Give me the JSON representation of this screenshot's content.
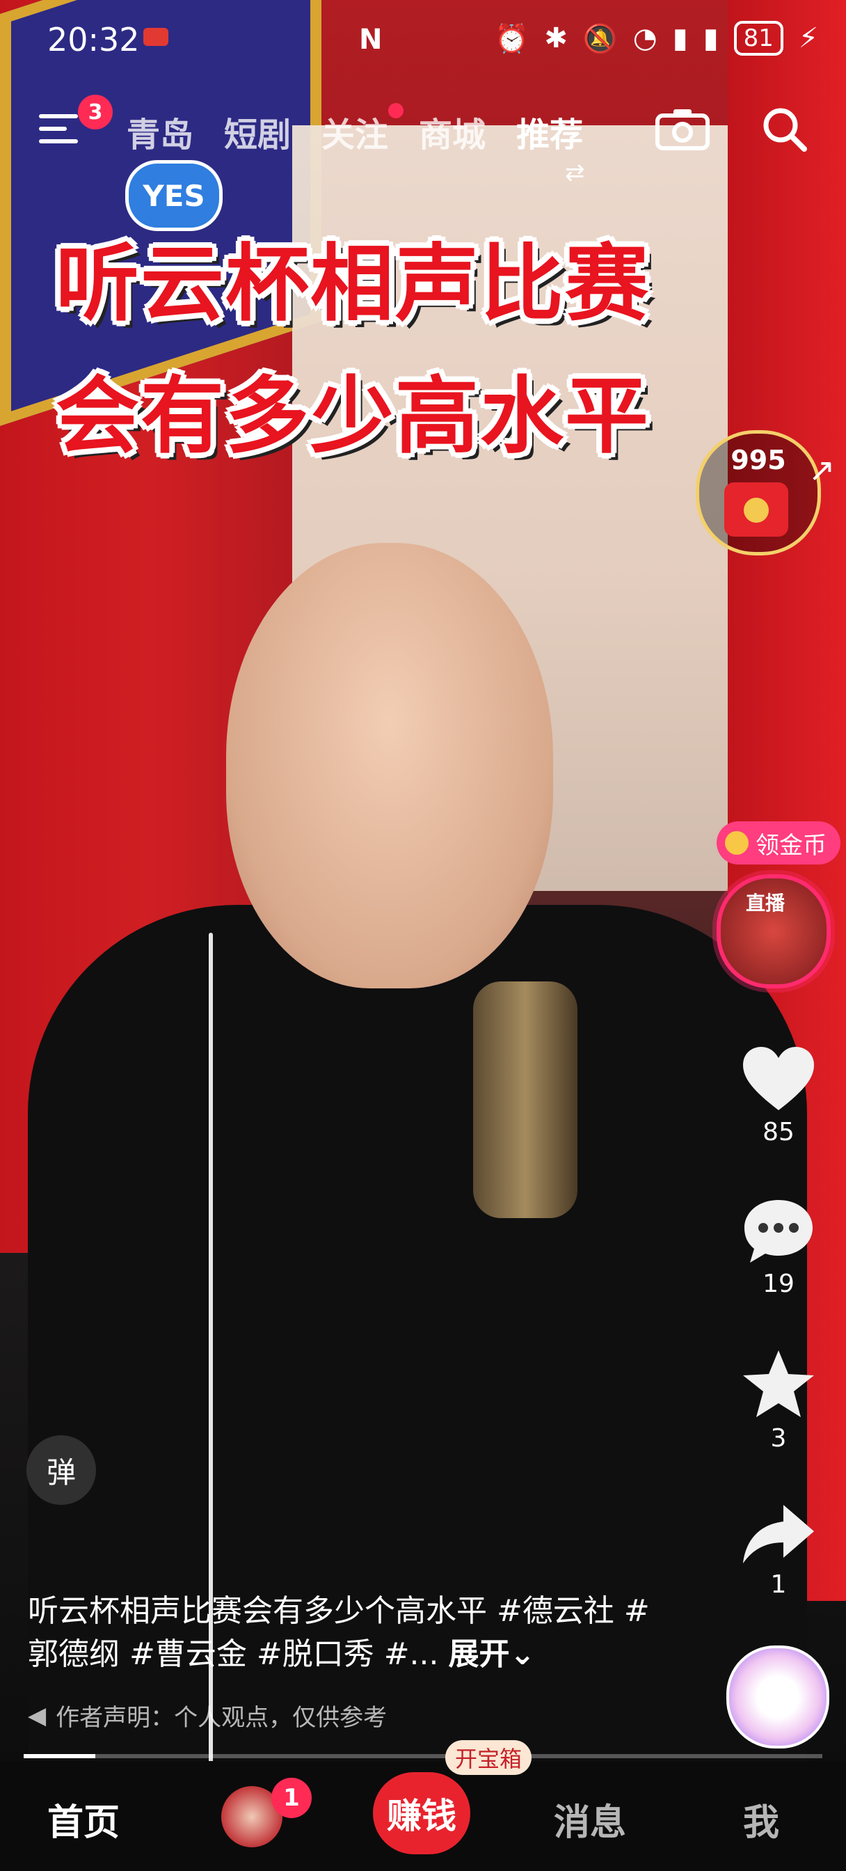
{
  "status_bar": {
    "time": "20:32",
    "nfc": "N",
    "battery": "81"
  },
  "top_nav": {
    "menu_badge": "3",
    "tabs": [
      {
        "label": "青岛"
      },
      {
        "label": "短剧"
      },
      {
        "label": "关注"
      },
      {
        "label": "商城"
      },
      {
        "label": "推荐"
      }
    ],
    "active_tab": "推荐",
    "swap_glyph": "⇄"
  },
  "video": {
    "caption_line1": "听云杯相声比赛",
    "caption_line2": "会有多少高水平",
    "yes_bubble": "YES"
  },
  "red_packet": {
    "count": "995"
  },
  "side_actions": {
    "coins_label": "领金币",
    "live_label": "直播",
    "like_count": "85",
    "comment_count": "19",
    "favorite_count": "3",
    "share_count": "1"
  },
  "danmaku": "弹",
  "description": {
    "text": "听云杯相声比赛会有多少个高水平 #德云社 #郭德纲 #曹云金 #脱口秀 #...",
    "expand_label": "展开",
    "disclaimer": "作者声明：个人观点，仅供参考"
  },
  "progress": 0.09,
  "bottom_nav": {
    "home": "首页",
    "friends_badge": "1",
    "earn": "赚钱",
    "chest": "开宝箱",
    "messages": "消息",
    "me": "我"
  },
  "colors": {
    "accent": "#ff2b55",
    "caption_red": "#e8141f"
  }
}
